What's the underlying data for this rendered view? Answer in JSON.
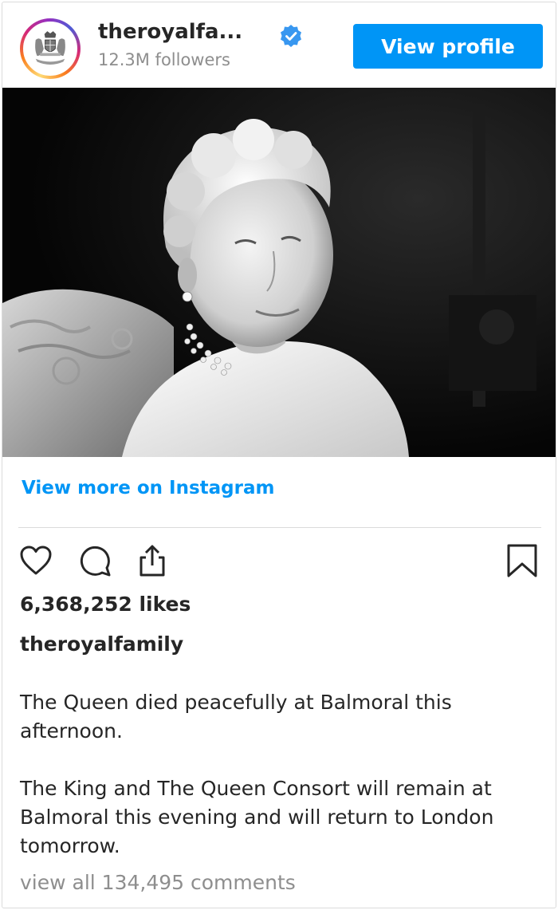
{
  "header": {
    "username": "theroyalfa...",
    "followers": "12.3M followers",
    "view_profile_label": "View profile",
    "avatar_icon": "royal-coat-of-arms",
    "verified_icon": "verified-badge"
  },
  "post": {
    "view_more_label": "View more on Instagram",
    "likes": "6,368,252 likes",
    "caption_user": "theroyalfamily",
    "caption_paragraphs": [
      "The Queen died peacefully at Balmoral this afternoon.",
      "The King and The Queen Consort will remain at Balmoral this evening and will return to London tomorrow."
    ],
    "view_comments": "view all 134,495 comments"
  },
  "actions": {
    "icons": [
      "heart-icon",
      "comment-icon",
      "share-icon",
      "bookmark-icon"
    ]
  },
  "colors": {
    "accent": "#0095f6",
    "text": "#262626",
    "muted": "#8e8e8e",
    "border": "#dbdbdb"
  }
}
